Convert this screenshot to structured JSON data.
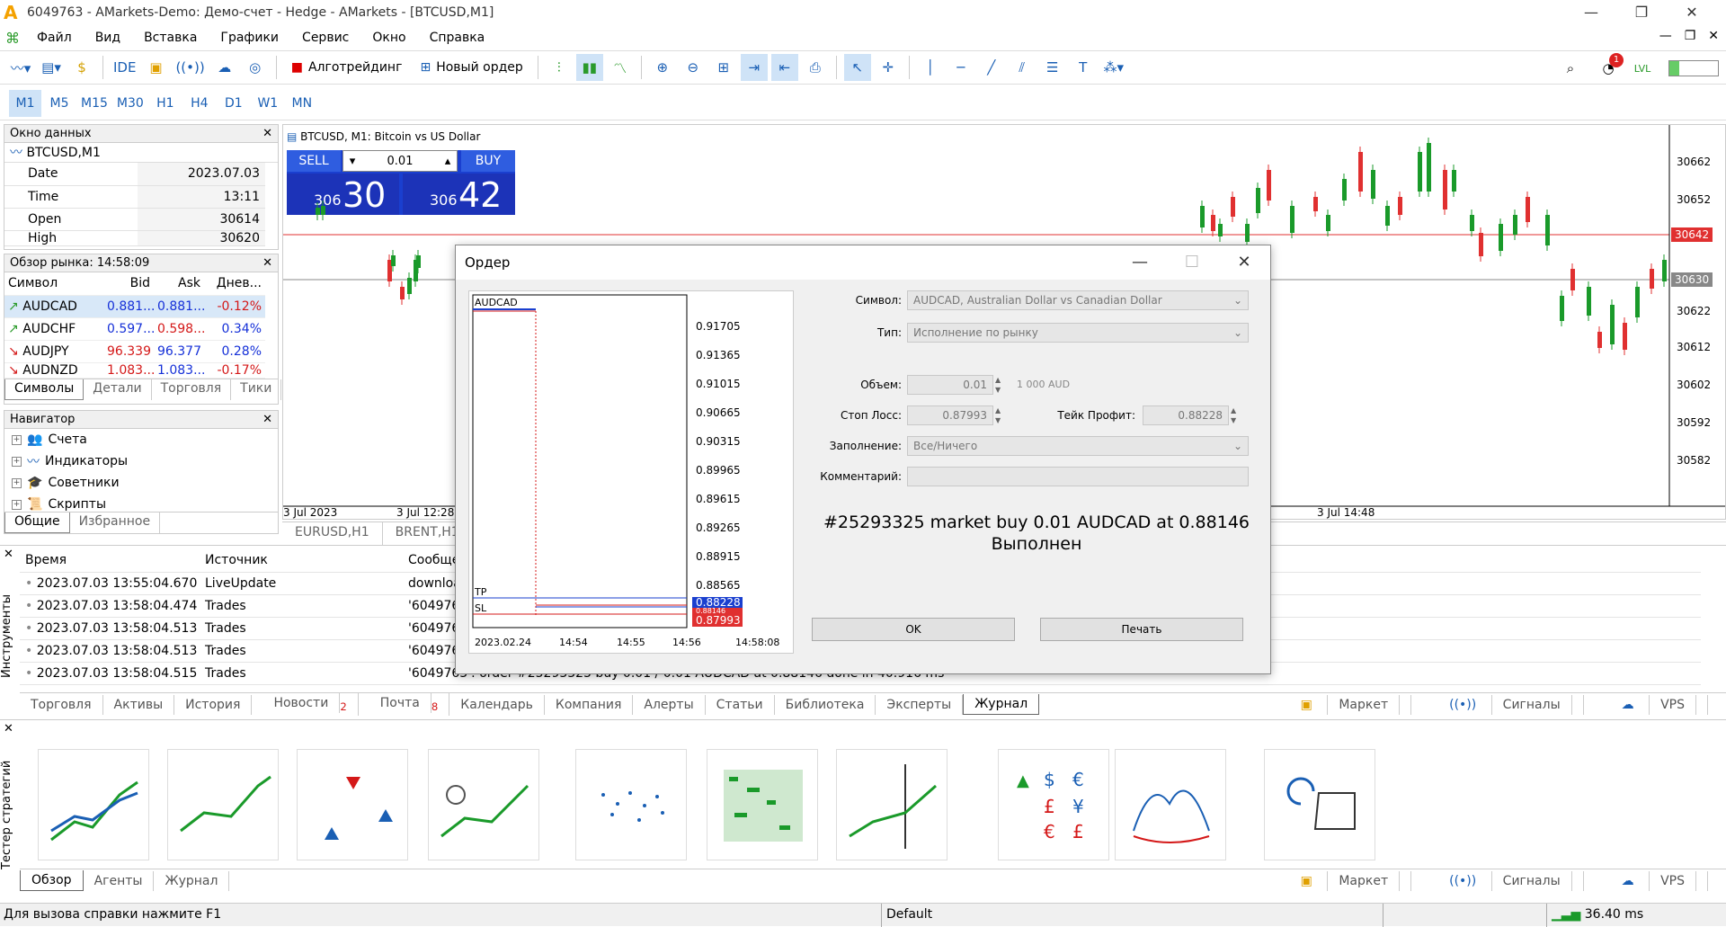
{
  "window": {
    "title": "6049763 - AMarkets-Demo: Демо-счет - Hedge - AMarkets - [BTCUSD,M1]"
  },
  "menu": [
    "Файл",
    "Вид",
    "Вставка",
    "Графики",
    "Сервис",
    "Окно",
    "Справка"
  ],
  "toolbar": {
    "ide": "IDE",
    "algo": "Алготрейдинг",
    "new_order": "Новый ордер",
    "notify_count": "1"
  },
  "timeframes": [
    "M1",
    "M5",
    "M15",
    "M30",
    "H1",
    "H4",
    "D1",
    "W1",
    "MN"
  ],
  "data_window": {
    "title": "Окно данных",
    "symbol": "BTCUSD,M1",
    "rows": [
      [
        "Date",
        "2023.07.03"
      ],
      [
        "Time",
        "13:11"
      ],
      [
        "Open",
        "30614"
      ],
      [
        "High",
        "30620"
      ]
    ]
  },
  "market_watch": {
    "title": "Обзор рынка: 14:58:09",
    "headers": [
      "Символ",
      "Bid",
      "Ask",
      "Днев..."
    ],
    "rows": [
      [
        "AUDCAD",
        "0.881...",
        "0.881...",
        "-0.12%"
      ],
      [
        "AUDCHF",
        "0.597...",
        "0.598...",
        "0.34%"
      ],
      [
        "AUDJPY",
        "96.339",
        "96.377",
        "0.28%"
      ],
      [
        "AUDNZD",
        "1.083...",
        "1.083...",
        "-0.17%"
      ]
    ],
    "tabs": [
      "Символы",
      "Детали",
      "Торговля",
      "Тики"
    ]
  },
  "navigator": {
    "title": "Навигатор",
    "items": [
      "Счета",
      "Индикаторы",
      "Советники",
      "Скрипты"
    ],
    "tabs": [
      "Общие",
      "Избранное"
    ]
  },
  "chart": {
    "header": "BTCUSD, M1:  Bitcoin vs US Dollar",
    "sell": "SELL",
    "buy": "BUY",
    "lot": "0.01",
    "sell_big": "30",
    "sell_small": "306",
    "buy_big": "42",
    "buy_small": "306",
    "prices": [
      "30662",
      "30652",
      "30642",
      "30630",
      "30622",
      "30612",
      "30602",
      "30592",
      "30582"
    ],
    "times": [
      "3 Jul 2023",
      "3 Jul 12:28",
      "3 Jul 14:48"
    ],
    "tabs": [
      "EURUSD,H1",
      "BRENT,H1"
    ]
  },
  "journal": {
    "headers": [
      "Время",
      "Источник",
      "Сообще"
    ],
    "rows": [
      [
        "2023.07.03 13:55:04.670",
        "LiveUpdate",
        "download"
      ],
      [
        "2023.07.03 13:58:04.474",
        "Trades",
        "'6049763"
      ],
      [
        "2023.07.03 13:58:04.513",
        "Trades",
        "'6049763"
      ],
      [
        "2023.07.03 13:58:04.513",
        "Trades",
        "'6049763"
      ],
      [
        "2023.07.03 13:58:04.515",
        "Trades",
        "'6049763': order #25293325 buy 0.01 / 0.01 AUDCAD at 0.88146 done in 40.916 ms"
      ]
    ],
    "tabs": [
      "Торговля",
      "Активы",
      "История",
      "Новости",
      "Почта",
      "Календарь",
      "Компания",
      "Алерты",
      "Статьи",
      "Библиотека",
      "Эксперты",
      "Журнал"
    ],
    "news_count": "2",
    "mail_count": "8",
    "side_label": "Инструменты"
  },
  "right_links": [
    "Маркет",
    "Сигналы",
    "VPS"
  ],
  "tester": {
    "side_label": "Тестер стратегий",
    "tabs": [
      "Обзор",
      "Агенты",
      "Журнал"
    ]
  },
  "status": {
    "help": "Для вызова справки нажмите F1",
    "profile": "Default",
    "ping": "36.40 ms"
  },
  "order_dialog": {
    "title": "Ордер",
    "chart_symbol": "AUDCAD",
    "prices": [
      "0.91705",
      "0.91365",
      "0.91015",
      "0.90665",
      "0.90315",
      "0.89965",
      "0.89615",
      "0.89265",
      "0.88915",
      "0.88565"
    ],
    "tp": "TP",
    "sl": "SL",
    "tp_price": "0.88228",
    "mid_price": "0.88146",
    "sl_price": "0.87993",
    "times": [
      "2023.02.24",
      "14:54",
      "14:55",
      "14:56",
      "14:58:08"
    ],
    "labels": {
      "symbol": "Символ:",
      "type": "Тип:",
      "volume": "Объем:",
      "sl": "Стоп Лосс:",
      "tp": "Тейк Профит:",
      "fill": "Заполнение:",
      "comment": "Комментарий:"
    },
    "values": {
      "symbol": "AUDCAD, Australian Dollar vs Canadian Dollar",
      "type": "Исполнение по рынку",
      "volume": "0.01",
      "volume_hint": "1 000 AUD",
      "sl": "0.87993",
      "tp": "0.88228",
      "fill": "Все/Ничего",
      "comment": ""
    },
    "result_line1": "#25293325 market buy 0.01 AUDCAD at 0.88146",
    "result_line2": "Выполнен",
    "ok": "OK",
    "print": "Печать"
  }
}
